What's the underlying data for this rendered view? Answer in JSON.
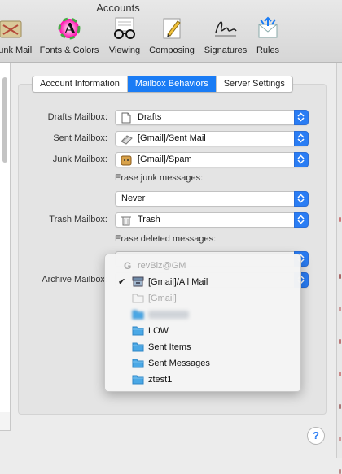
{
  "window": {
    "title": "Accounts"
  },
  "toolbar": {
    "items": [
      {
        "label": "Junk Mail",
        "icon": "junk-mail-icon"
      },
      {
        "label": "Fonts & Colors",
        "icon": "fonts-colors-icon"
      },
      {
        "label": "Viewing",
        "icon": "glasses-icon"
      },
      {
        "label": "Composing",
        "icon": "pencil-icon"
      },
      {
        "label": "Signatures",
        "icon": "signature-icon"
      },
      {
        "label": "Rules",
        "icon": "rules-icon"
      }
    ]
  },
  "tabs": [
    {
      "label": "Account Information",
      "active": false
    },
    {
      "label": "Mailbox Behaviors",
      "active": true
    },
    {
      "label": "Server Settings",
      "active": false
    }
  ],
  "form": {
    "drafts": {
      "label": "Drafts Mailbox:",
      "value": "Drafts",
      "icon": "document-icon"
    },
    "sent": {
      "label": "Sent Mailbox:",
      "value": "[Gmail]/Sent Mail",
      "icon": "sent-icon"
    },
    "junk": {
      "label": "Junk Mailbox:",
      "value": "[Gmail]/Spam",
      "icon": "junk-icon"
    },
    "erase_junk": {
      "label": "Erase junk messages:",
      "value": "Never"
    },
    "trash": {
      "label": "Trash Mailbox:",
      "value": "Trash",
      "icon": "trash-icon"
    },
    "erase_deleted": {
      "label": "Erase deleted messages:"
    },
    "archive": {
      "label": "Archive Mailbox:"
    }
  },
  "menu": {
    "header": "revBiz@GM",
    "items": [
      {
        "label": "[Gmail]/All Mail",
        "checked": true,
        "icon": "archive-box-icon"
      },
      {
        "label": "[Gmail]",
        "checked": false,
        "disabled": true,
        "icon": "folder-outline-icon"
      },
      {
        "label": "",
        "checked": false,
        "blurred": true,
        "icon": "folder-icon"
      },
      {
        "label": "LOW",
        "checked": false,
        "icon": "folder-icon"
      },
      {
        "label": "Sent Items",
        "checked": false,
        "icon": "folder-icon"
      },
      {
        "label": "Sent Messages",
        "checked": false,
        "icon": "folder-icon"
      },
      {
        "label": "ztest1",
        "checked": false,
        "icon": "folder-icon"
      }
    ]
  },
  "help": {
    "label": "?"
  },
  "colors": {
    "accent": "#1a7cf5",
    "folder": "#4aa8e6"
  }
}
